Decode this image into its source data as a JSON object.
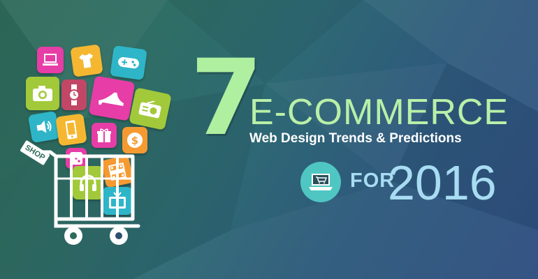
{
  "banner": {
    "number": "7",
    "headline": "E-COMMERCE",
    "subline": "Web Design Trends & Predictions",
    "for_word": "FOR",
    "year": "2016"
  },
  "cart": {
    "sign_text": "SHOP"
  },
  "icons": [
    "laptop-icon",
    "tshirt-icon",
    "gamepad-icon",
    "camera-icon",
    "watch-icon",
    "high-heel-shoe-icon",
    "radio-icon",
    "speaker-icon",
    "smartphone-icon",
    "gift-icon",
    "dollar-icon",
    "dice-icon",
    "film-icon",
    "headphones-icon",
    "tv-icon",
    "shopping-cart-icon",
    "laptop-cart-icon"
  ],
  "colors": {
    "number": "#aef0a0",
    "headline": "#b9f0a8",
    "year_text": "#a8dcf2",
    "badge": "#4fc6c2",
    "bg_left": "#2f6b5a",
    "bg_right": "#2f4f80"
  }
}
